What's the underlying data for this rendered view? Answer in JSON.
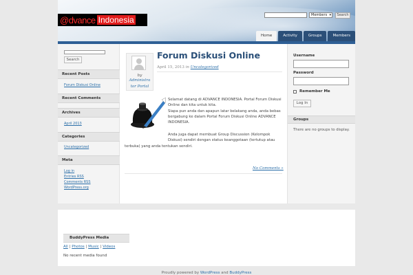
{
  "site": {
    "logo_prefix": "@dvance",
    "logo_suffix": "Indonesia",
    "colors": {
      "nav_dark": "#2b4f78",
      "link": "#2a6ea8",
      "logo_red": "#e11c1c"
    }
  },
  "header_search": {
    "select_value": "Members",
    "button_label": "Search"
  },
  "nav": {
    "tabs": [
      {
        "label": "Home"
      },
      {
        "label": "Activity"
      },
      {
        "label": "Groups"
      },
      {
        "label": "Members"
      }
    ]
  },
  "left_sidebar": {
    "search_button": "Search",
    "recent_posts_title": "Recent Posts",
    "recent_posts": [
      "Forum Diskusi Online"
    ],
    "recent_comments_title": "Recent Comments",
    "archives_title": "Archives",
    "archives": [
      "April 2013"
    ],
    "categories_title": "Categories",
    "categories": [
      "Uncategorized"
    ],
    "meta_title": "Meta",
    "meta_links": [
      "Log in",
      "Entries RSS",
      "Comments RSS",
      "WordPress.org"
    ]
  },
  "post": {
    "title": "Forum Diskusi Online",
    "date": "April 15, 2013",
    "in_label": "in",
    "category": "Uncategorized",
    "by_label": "by",
    "author_line1": "Administra",
    "author_line2": "tor Portal",
    "paragraph1_lines": [
      "Selamat datang di ADVANCE INDONESIA. Portal Forum Diskusi",
      "Online dan kita untuk kita.",
      "Siapa pun anda dan apapun latar belakang anda, anda bebas",
      "bergabung ke dalam Portal Forum Diskusi Online ADVANCE",
      "INDONESIA."
    ],
    "paragraph2_lines": [
      "Anda juga dapat membuat Group Discussion (Kelompok",
      "Diskusi) sendiri dengan status keanggotaan (tertutup atau",
      "terbuka) yang anda tentukan sendiri."
    ],
    "comments_link": "No Comments »",
    "image_icon": "inkwell-quill-icon"
  },
  "right_sidebar": {
    "username_label": "Username",
    "password_label": "Password",
    "remember_label": "Remember Me",
    "login_button": "Log In",
    "groups_title": "Groups",
    "groups_empty": "There are no groups to display."
  },
  "footer_widget": {
    "title": "BuddyPress Media",
    "filter_all": "All",
    "filter_photos": "Photos",
    "filter_music": "Music",
    "filter_videos": "Videos",
    "separator": "|",
    "empty_text": "No recent media found"
  },
  "footer": {
    "powered_prefix": "Proudly powered by",
    "wordpress": "WordPress",
    "and": "and",
    "buddypress": "BuddyPress"
  }
}
